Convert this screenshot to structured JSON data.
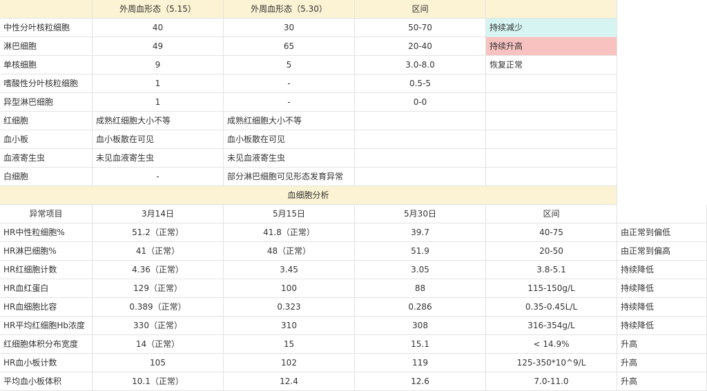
{
  "colors": {
    "header_bg": "#fbf3d3",
    "decrease_bg": "#d6f5f2",
    "increase_bg": "#f7c2c0",
    "grid_line": "#e3e3e3"
  },
  "morphology": {
    "headers": [
      "",
      "外周血形态（5.15）",
      "外周血形态（5.30）",
      "区间",
      ""
    ],
    "rows": [
      [
        "中性分叶核粒细胞",
        "40",
        "30",
        "50-70",
        "持续减少"
      ],
      [
        "淋巴细胞",
        "49",
        "65",
        "20-40",
        "持续升高"
      ],
      [
        "单核细胞",
        "9",
        "5",
        "3.0-8.0",
        "恢复正常"
      ],
      [
        "嗜酸性分叶核粒细胞",
        "1",
        "-",
        "0.5-5",
        ""
      ],
      [
        "异型淋巴细胞",
        "1",
        "-",
        "0-0",
        ""
      ],
      [
        "红细胞",
        "成熟红细胞大小不等",
        "成熟红细胞大小不等",
        "",
        ""
      ],
      [
        "血小板",
        "血小板散在可见",
        "血小板散在可见",
        "",
        ""
      ],
      [
        "血液寄生虫",
        "未见血液寄生虫",
        "未见血液寄生虫",
        "",
        ""
      ],
      [
        "白细胞",
        "-",
        "部分淋巴细胞可见形态发育异常",
        "",
        ""
      ]
    ]
  },
  "cbc": {
    "title": "血细胞分析",
    "headers": [
      "异常项目",
      "3月14日",
      "5月15日",
      "5月30日",
      "区间",
      ""
    ],
    "rows": [
      [
        "HR中性粒细胞%",
        "51.2（正常）",
        "41.8（正常）",
        "39.7",
        "40-75",
        "由正常到偏低"
      ],
      [
        "HR淋巴细胞%",
        "41（正常）",
        "48（正常）",
        "51.9",
        "20-50",
        "由正常到偏高"
      ],
      [
        "HR红细胞计数",
        "4.36（正常）",
        "3.45",
        "3.05",
        "3.8-5.1",
        "持续降低"
      ],
      [
        "HR血红蛋白",
        "129（正常）",
        "100",
        "88",
        "115-150g/L",
        "持续降低"
      ],
      [
        "HR血细胞比容",
        "0.389（正常）",
        "0.323",
        "0.286",
        "0.35-0.45L/L",
        "持续降低"
      ],
      [
        "HR平均红细胞Hb浓度",
        "330（正常）",
        "310",
        "308",
        "316-354g/L",
        "持续降低"
      ],
      [
        "红细胞体积分布宽度",
        "14（正常）",
        "15",
        "15.1",
        "< 14.9%",
        "升高"
      ],
      [
        "HR血小板计数",
        "105",
        "102",
        "119",
        "125-350*10^9/L",
        "升高"
      ],
      [
        "平均血小板体积",
        "10.1（正常）",
        "12.4",
        "12.6",
        "7.0-11.0",
        "升高"
      ]
    ]
  }
}
